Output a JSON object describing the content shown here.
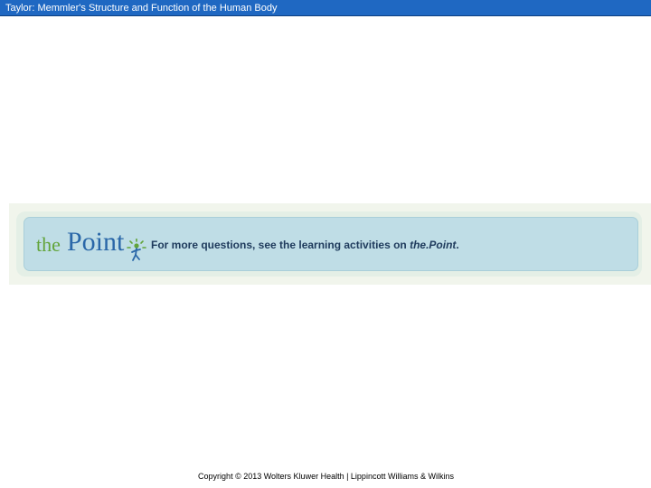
{
  "header": {
    "title": "Taylor: Memmler's Structure and Function of the Human Body"
  },
  "banner": {
    "logo_prefix": "the",
    "logo_main": "Point",
    "message_prefix": "For more questions, see the learning activities on ",
    "message_link": "the.Point",
    "message_suffix": "."
  },
  "footer": {
    "copyright": "Copyright © 2013 Wolters Kluwer Health | Lippincott Williams & Wilkins"
  },
  "colors": {
    "title_bar": "#1f68c2",
    "banner_bg": "#bfdde6",
    "logo_green": "#62a43a",
    "logo_blue": "#2a67a8"
  }
}
